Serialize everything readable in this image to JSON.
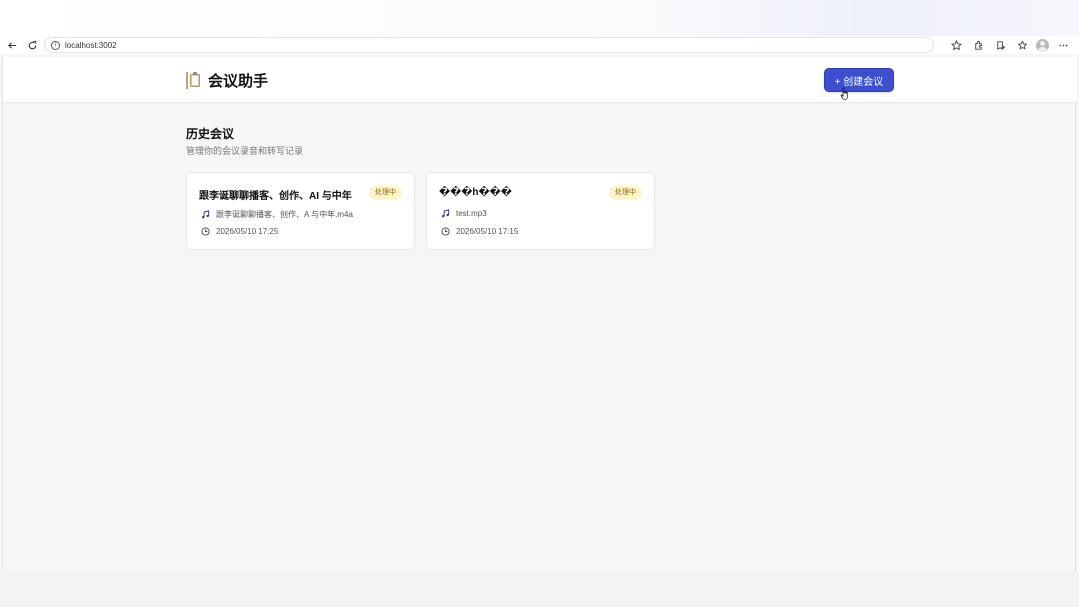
{
  "browser": {
    "url": "localhost:3002"
  },
  "header": {
    "title": "会议助手",
    "create_button": "+ 创建会议"
  },
  "section": {
    "title": "历史会议",
    "subtitle": "管理你的会议录音和转写记录"
  },
  "meetings": [
    {
      "title": "跟李诞聊聊播客、创作、AI 与中年",
      "status": "处理中",
      "file": "跟李诞聊聊播客、创作、A 与中年.m4a",
      "time": "2026/05/10 17:25"
    },
    {
      "title": "���h���",
      "status": "处理中",
      "file": "test.mp3",
      "time": "2026/05/10 17:15"
    }
  ],
  "colors": {
    "primary": "#3b4fd0",
    "badge_bg": "#fdf4c8",
    "badge_text": "#8a6d12",
    "page_bg": "#f5f6f7"
  },
  "icons": [
    "back-icon",
    "reload-icon",
    "info-icon",
    "star-icon",
    "extension-icon",
    "favorites-icon",
    "collections-icon",
    "profile-avatar",
    "more-icon",
    "clipboard-icon",
    "music-note-icon",
    "clock-icon",
    "cursor-hand-icon"
  ]
}
